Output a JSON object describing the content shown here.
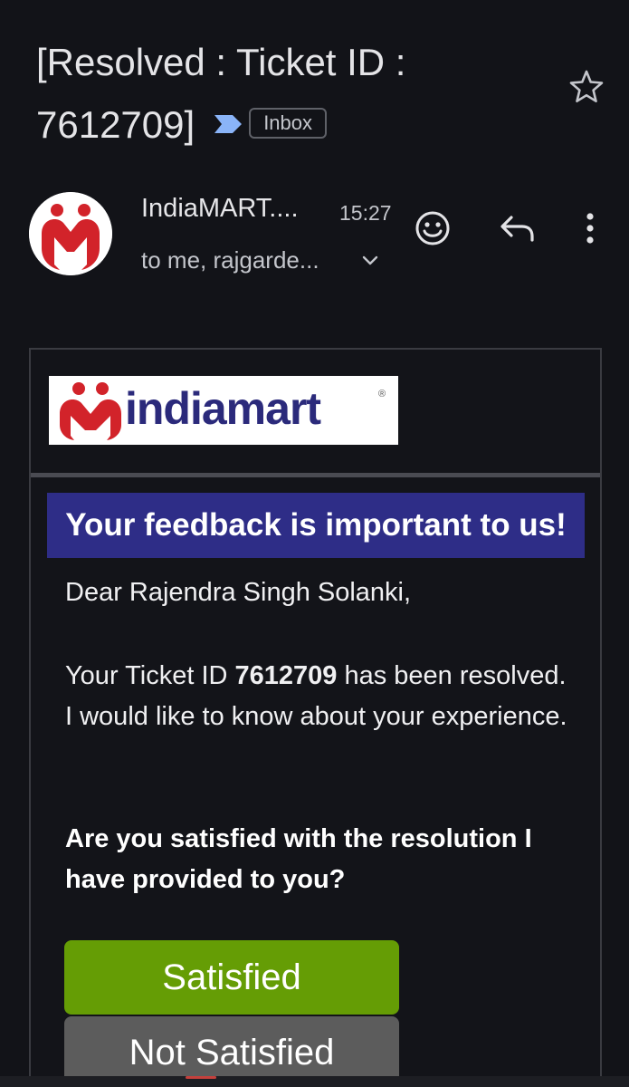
{
  "subject": {
    "title": "[Resolved : Ticket ID : 7612709]",
    "label_chip": "Inbox"
  },
  "sender": {
    "name": "IndiaMART....",
    "time": "15:27",
    "recipients": "to me, rajgarde..."
  },
  "email": {
    "brand_wordmark": "indiamart",
    "brand_registered": "®",
    "heading": "Your feedback is important to us!",
    "greeting": "Dear Rajendra Singh Solanki,",
    "message_prefix": "Your Ticket ID ",
    "ticket_id": "7612709",
    "message_suffix": " has been resolved. I would like to know about your experience.",
    "question": "Are you satisfied with the resolution I have provided to you?",
    "satisfied_label": "Satisfied",
    "not_satisfied_label": "Not Satisfied"
  },
  "colors": {
    "background": "#121318",
    "heading_bg": "#2e2d87",
    "satisfied_bg": "#659d05",
    "not_satisfied_bg": "#5c5c5c",
    "brand_red": "#d2232a",
    "brand_navy": "#2b2a7b",
    "label_arrow": "#8ab4f8"
  },
  "icons": {
    "star": "star-outline-icon",
    "emoji": "smiley-face-icon",
    "reply": "reply-arrow-icon",
    "more": "more-vertical-icon",
    "expand": "chevron-down-icon",
    "importance": "importance-marker-icon"
  }
}
